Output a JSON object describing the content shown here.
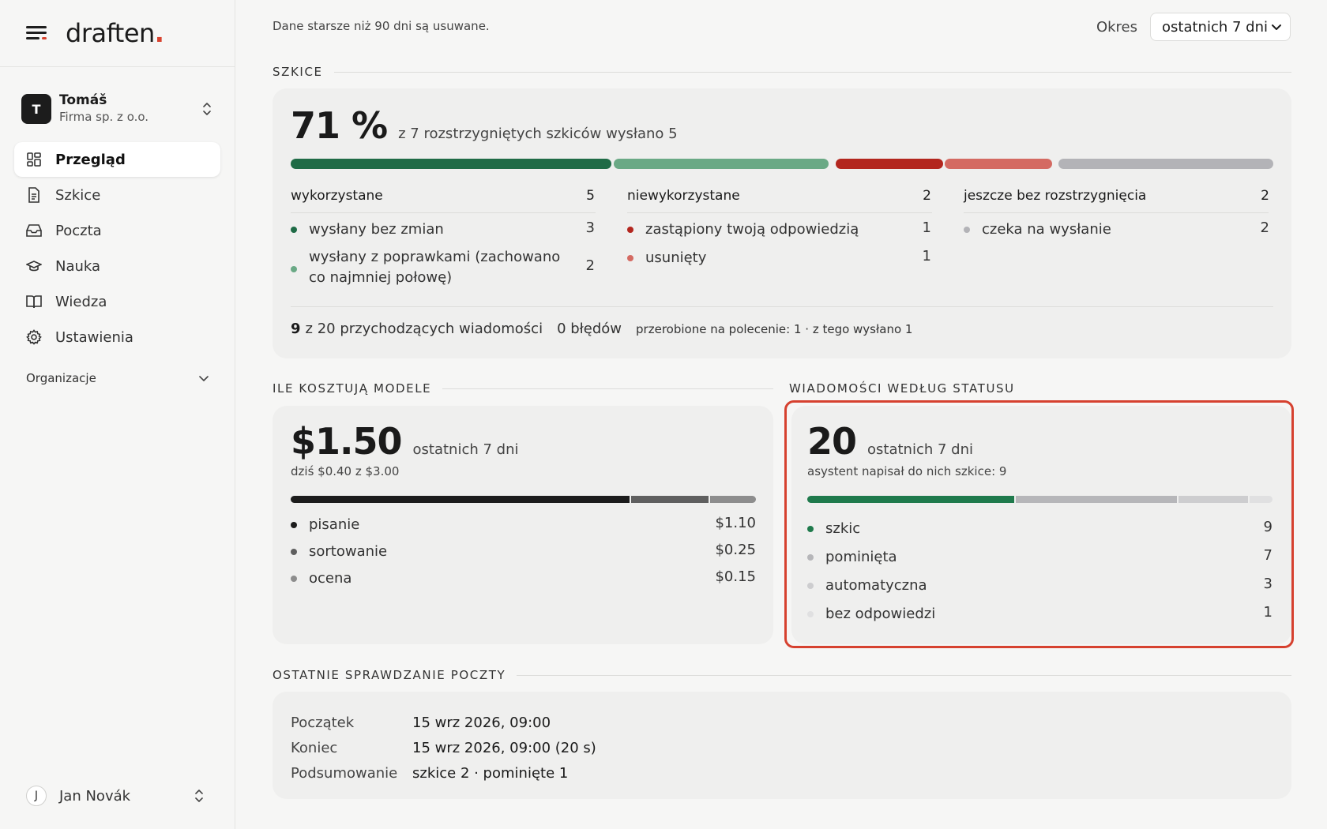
{
  "brand": {
    "name": "draften",
    "dot": "."
  },
  "account": {
    "initial": "T",
    "name": "Tomáš",
    "org": "Firma sp. z o.o."
  },
  "nav": {
    "items": [
      {
        "label": "Przegląd",
        "icon": "grid-icon",
        "active": true
      },
      {
        "label": "Szkice",
        "icon": "document-icon"
      },
      {
        "label": "Poczta",
        "icon": "inbox-icon"
      },
      {
        "label": "Nauka",
        "icon": "graduation-cap-icon"
      },
      {
        "label": "Wiedza",
        "icon": "book-icon"
      },
      {
        "label": "Ustawienia",
        "icon": "gear-icon"
      }
    ],
    "orgs_label": "Organizacje"
  },
  "user": {
    "initial": "J",
    "name": "Jan Novák"
  },
  "header": {
    "notice": "Dane starsze niż 90 dni są usuwane.",
    "period_label": "Okres",
    "period_value": "ostatnich 7 dni"
  },
  "drafts": {
    "section_title": "SZKICE",
    "percent": "71 %",
    "summary": "z 7 rozstrzygniętych szkiców wysłano 5",
    "bar_counts": {
      "sent_unchanged": 3,
      "sent_edited": 2,
      "replaced": 1,
      "deleted": 1,
      "pending": 2
    },
    "columns": [
      {
        "title": "wykorzystane",
        "count": "5",
        "items": [
          {
            "label": "wysłany bez zmian",
            "value": "3",
            "color": "#1f6b46"
          },
          {
            "label": "wysłany z poprawkami (zachowano co najmniej połowę)",
            "value": "2",
            "color": "#6aa985"
          }
        ]
      },
      {
        "title": "niewykorzystane",
        "count": "2",
        "items": [
          {
            "label": "zastąpiony twoją odpowiedzią",
            "value": "1",
            "color": "#b3261e"
          },
          {
            "label": "usunięty",
            "value": "1",
            "color": "#d46a62"
          }
        ]
      },
      {
        "title": "jeszcze bez rozstrzygnięcia",
        "count": "2",
        "items": [
          {
            "label": "czeka na wysłanie",
            "value": "2",
            "color": "#b3b3b7"
          }
        ]
      }
    ],
    "footer": {
      "incoming_count": "9",
      "incoming_text": "z 20 przychodzących wiadomości",
      "errors": "0 błędów",
      "reworked": "przerobione na polecenie: 1 · z tego wysłano 1"
    }
  },
  "costs": {
    "section_title": "ILE KOSZTUJĄ MODELE",
    "amount": "$1.50",
    "period": "ostatnich 7 dni",
    "today": "dziś $0.40 z $3.00",
    "items": [
      {
        "label": "pisanie",
        "value": "$1.10",
        "color": "#1c1c1c",
        "amount": 1.1
      },
      {
        "label": "sortowanie",
        "value": "$0.25",
        "color": "#5f5f5f",
        "amount": 0.25
      },
      {
        "label": "ocena",
        "value": "$0.15",
        "color": "#8d8d8d",
        "amount": 0.15
      }
    ]
  },
  "status": {
    "section_title": "WIADOMOŚCI WEDŁUG STATUSU",
    "count": "20",
    "period": "ostatnich 7 dni",
    "subtitle": "asystent napisał do nich szkice: 9",
    "items": [
      {
        "label": "szkic",
        "value": "9",
        "color": "#1f7a4c",
        "amount": 9
      },
      {
        "label": "pominięta",
        "value": "7",
        "color": "#b6b6b9",
        "amount": 7
      },
      {
        "label": "automatyczna",
        "value": "3",
        "color": "#cdcdcf",
        "amount": 3
      },
      {
        "label": "bez odpowiedzi",
        "value": "1",
        "color": "#e0e0e1",
        "amount": 1
      }
    ]
  },
  "last_check": {
    "section_title": "OSTATNIE SPRAWDZANIE POCZTY",
    "rows": [
      {
        "label": "Początek",
        "value": "15 wrz 2026, 09:00"
      },
      {
        "label": "Koniec",
        "value": "15 wrz 2026, 09:00 (20 s)"
      },
      {
        "label": "Podsumowanie",
        "value": "szkice 2 · pominięte 1"
      }
    ]
  }
}
